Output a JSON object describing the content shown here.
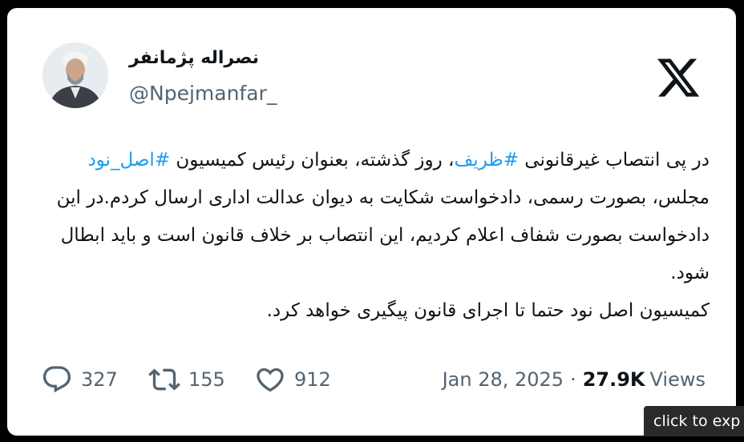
{
  "tweet": {
    "author_name": "نصراله پژمانفر",
    "handle": "@Npejmanfar_",
    "text_parts": [
      "در پی انتصاب غیرقانونی ",
      "#ظریف",
      "، روز گذشته، بعنوان رئیس کمیسیون ",
      "#اصل_نود",
      " مجلس، بصورت رسمی، دادخواست شکایت به دیوان عدالت اداری ارسال کردم.در این دادخواست بصورت شفاف اعلام کردیم، این انتصاب بر خلاف قانون است و باید ابطال شود.",
      "کمیسیون اصل نود حتما تا اجرای قانون پیگیری خواهد کرد."
    ],
    "stats": {
      "replies": "327",
      "retweets": "155",
      "likes": "912"
    },
    "date": "Jan 28, 2025",
    "separator": "·",
    "views_count": "27.9K",
    "views_label": "Views"
  },
  "tooltip": {
    "text": "click to exp"
  },
  "colors": {
    "hashtag": "#1d9bf0",
    "text": "#0f1419",
    "secondary": "#536471"
  },
  "icons": [
    "x-logo-icon",
    "reply-icon",
    "retweet-icon",
    "like-icon"
  ]
}
